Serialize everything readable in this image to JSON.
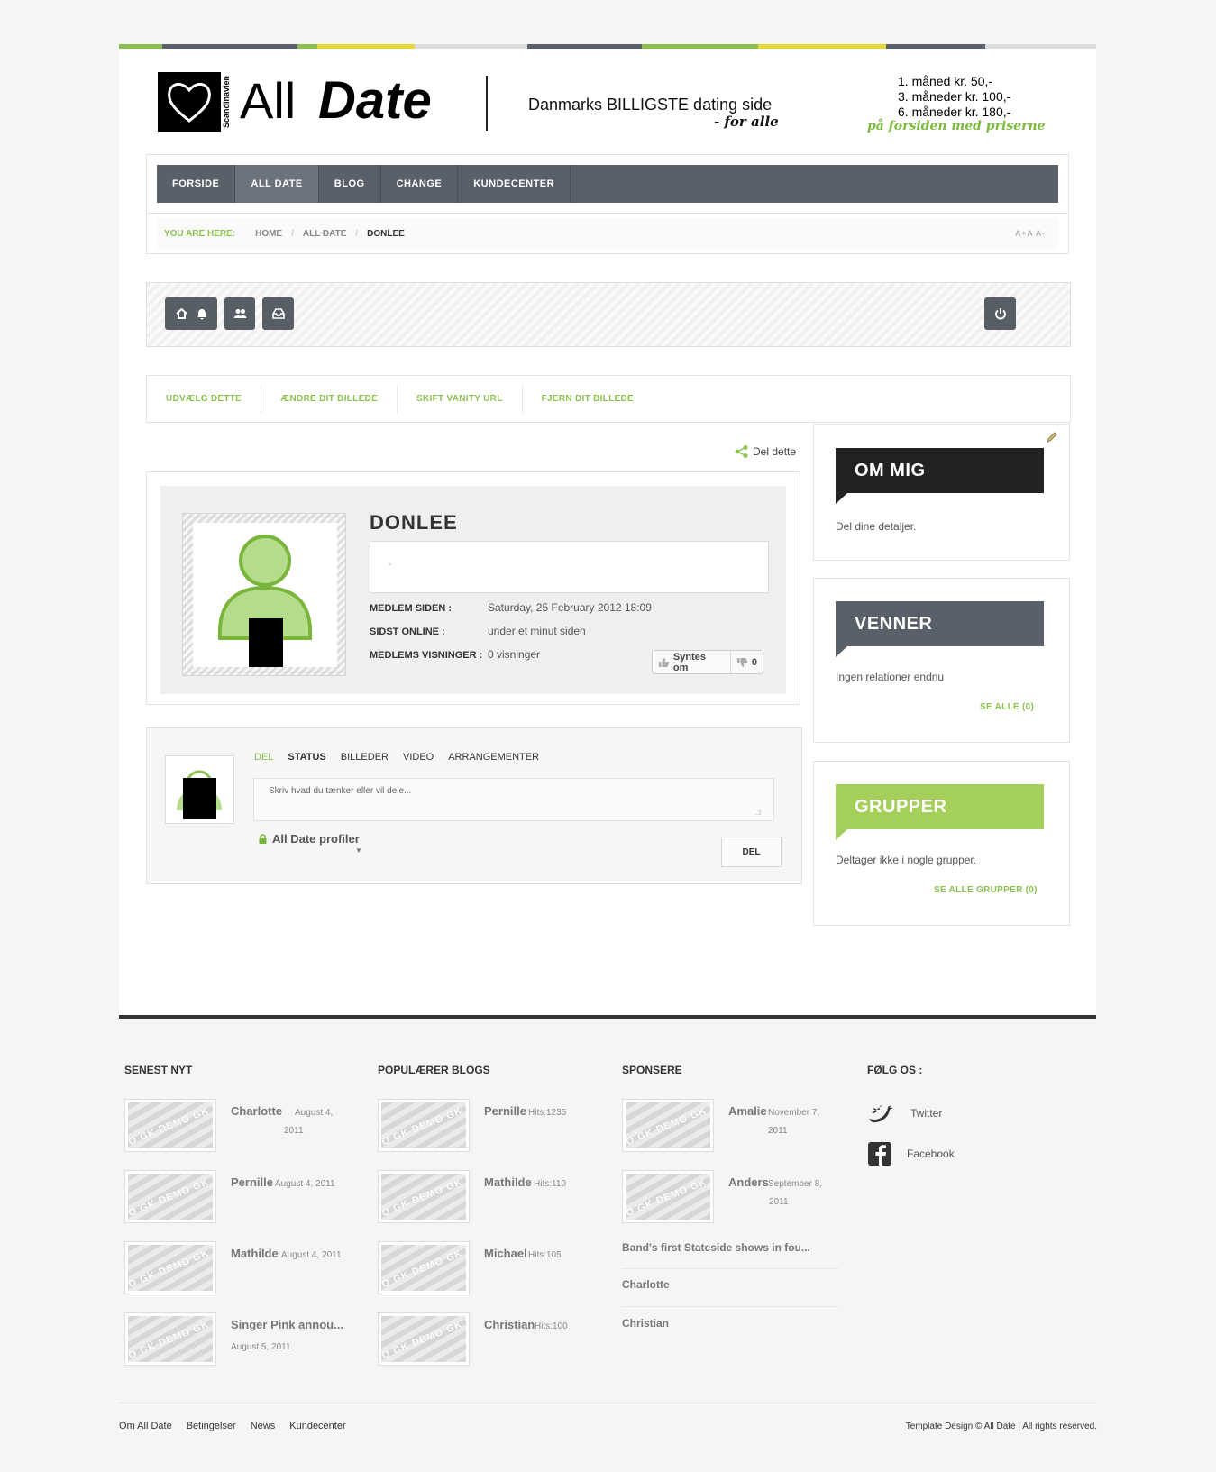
{
  "colors": {
    "accent": "#8cc152",
    "nav": "#5a6069",
    "dark": "#222222",
    "stripe": [
      "#8cc152",
      "#5a6069",
      "#e8d63a",
      "#dddddd",
      "#5a6069",
      "#8cc152",
      "#e8d63a",
      "#5a6069",
      "#dddddd"
    ]
  },
  "header": {
    "logo_side_text": "Scandinavien",
    "logo_all": "All",
    "logo_date": "Date",
    "tagline": "Danmarks BILLIGSTE dating side",
    "tagline_sub": "- for alle",
    "prices": [
      "1. måned kr. 50,-",
      "3. måneder kr. 100,-",
      "6. måneder kr. 180,-"
    ],
    "prices_note": "på forsiden med priserne"
  },
  "nav": {
    "items": [
      {
        "label": "FORSIDE",
        "active": false
      },
      {
        "label": "ALL DATE",
        "active": true
      },
      {
        "label": "BLOG",
        "active": false
      },
      {
        "label": "CHANGE",
        "active": false
      },
      {
        "label": "KUNDECENTER",
        "active": false
      }
    ]
  },
  "breadcrumb": {
    "label": "YOU ARE HERE:",
    "items": [
      "HOME",
      "ALL DATE",
      "DONLEE"
    ],
    "font_controls": "A+A  A-"
  },
  "toolbar": {
    "icons": [
      "home-icon",
      "bell-icon",
      "users-icon",
      "inbox-icon",
      "power-icon"
    ]
  },
  "actions": [
    "UDVÆLG DETTE",
    "ÆNDRE DIT BILLEDE",
    "SKIFT VANITY URL",
    "FJERN DIT BILLEDE"
  ],
  "share": {
    "label": "Del dette"
  },
  "profile": {
    "name": "DONLEE",
    "status_placeholder": "-",
    "member_since_label": "MEDLEM SIDEN :",
    "member_since_value": "Saturday, 25 February 2012 18:09",
    "last_online_label": "SIDST ONLINE :",
    "last_online_value": "under et minut siden",
    "views_label": "MEDLEMS VISNINGER :",
    "views_value": "0 visninger",
    "like_label": "Syntes om",
    "dislike_count": "0"
  },
  "composer": {
    "tabs": [
      "DEL",
      "STATUS",
      "BILLEDER",
      "VIDEO",
      "ARRANGEMENTER"
    ],
    "placeholder": "Skriv hvad du tænker eller vil dele...",
    "privacy": "All Date profiler",
    "submit": "DEL"
  },
  "sidebar": {
    "about": {
      "title": "OM MIG",
      "text": "Del dine detaljer."
    },
    "friends": {
      "title": "VENNER",
      "text": "Ingen relationer endnu",
      "link": "SE ALLE (0)"
    },
    "groups": {
      "title": "GRUPPER",
      "text": "Deltager ikke i nogle grupper.",
      "link": "SE ALLE GRUPPER (0)"
    }
  },
  "footer": {
    "thumb_text": "DEMO GK DEMO GK DEM",
    "latest": {
      "title": "SENEST NYT",
      "items": [
        {
          "name": "Charlotte",
          "meta": "August 4,",
          "meta2": "2011"
        },
        {
          "name": "Pernille",
          "meta": "August 4, 2011",
          "meta2": ""
        },
        {
          "name": "Mathilde",
          "meta": "August 4, 2011",
          "meta2": ""
        },
        {
          "name": "Singer Pink annou...",
          "meta": "",
          "meta2": "August 5, 2011"
        }
      ]
    },
    "blogs": {
      "title": "POPULÆRER BLOGS",
      "items": [
        {
          "name": "Pernille",
          "meta": "Hits:1235"
        },
        {
          "name": "Mathilde",
          "meta": "Hits:110"
        },
        {
          "name": "Michael",
          "meta": "Hits:105"
        },
        {
          "name": "Christian",
          "meta": "Hits:100"
        }
      ]
    },
    "sponsors": {
      "title": "SPONSERE",
      "items": [
        {
          "name": "Amalie",
          "meta": "November 7,",
          "meta2": "2011"
        },
        {
          "name": "Anders",
          "meta": "September 8,",
          "meta2": "2011"
        }
      ],
      "links": [
        "Band's first Stateside shows in fou...",
        "Charlotte",
        "Christian"
      ]
    },
    "follow": {
      "title": "FØLG OS :",
      "items": [
        {
          "label": "Twitter",
          "icon": "twitter-icon"
        },
        {
          "label": "Facebook",
          "icon": "facebook-icon"
        }
      ]
    },
    "bottom_links": [
      "Om All Date",
      "Betingelser",
      "News",
      "Kundecenter"
    ],
    "copyright": "Template Design © All Date | All rights reserved."
  }
}
